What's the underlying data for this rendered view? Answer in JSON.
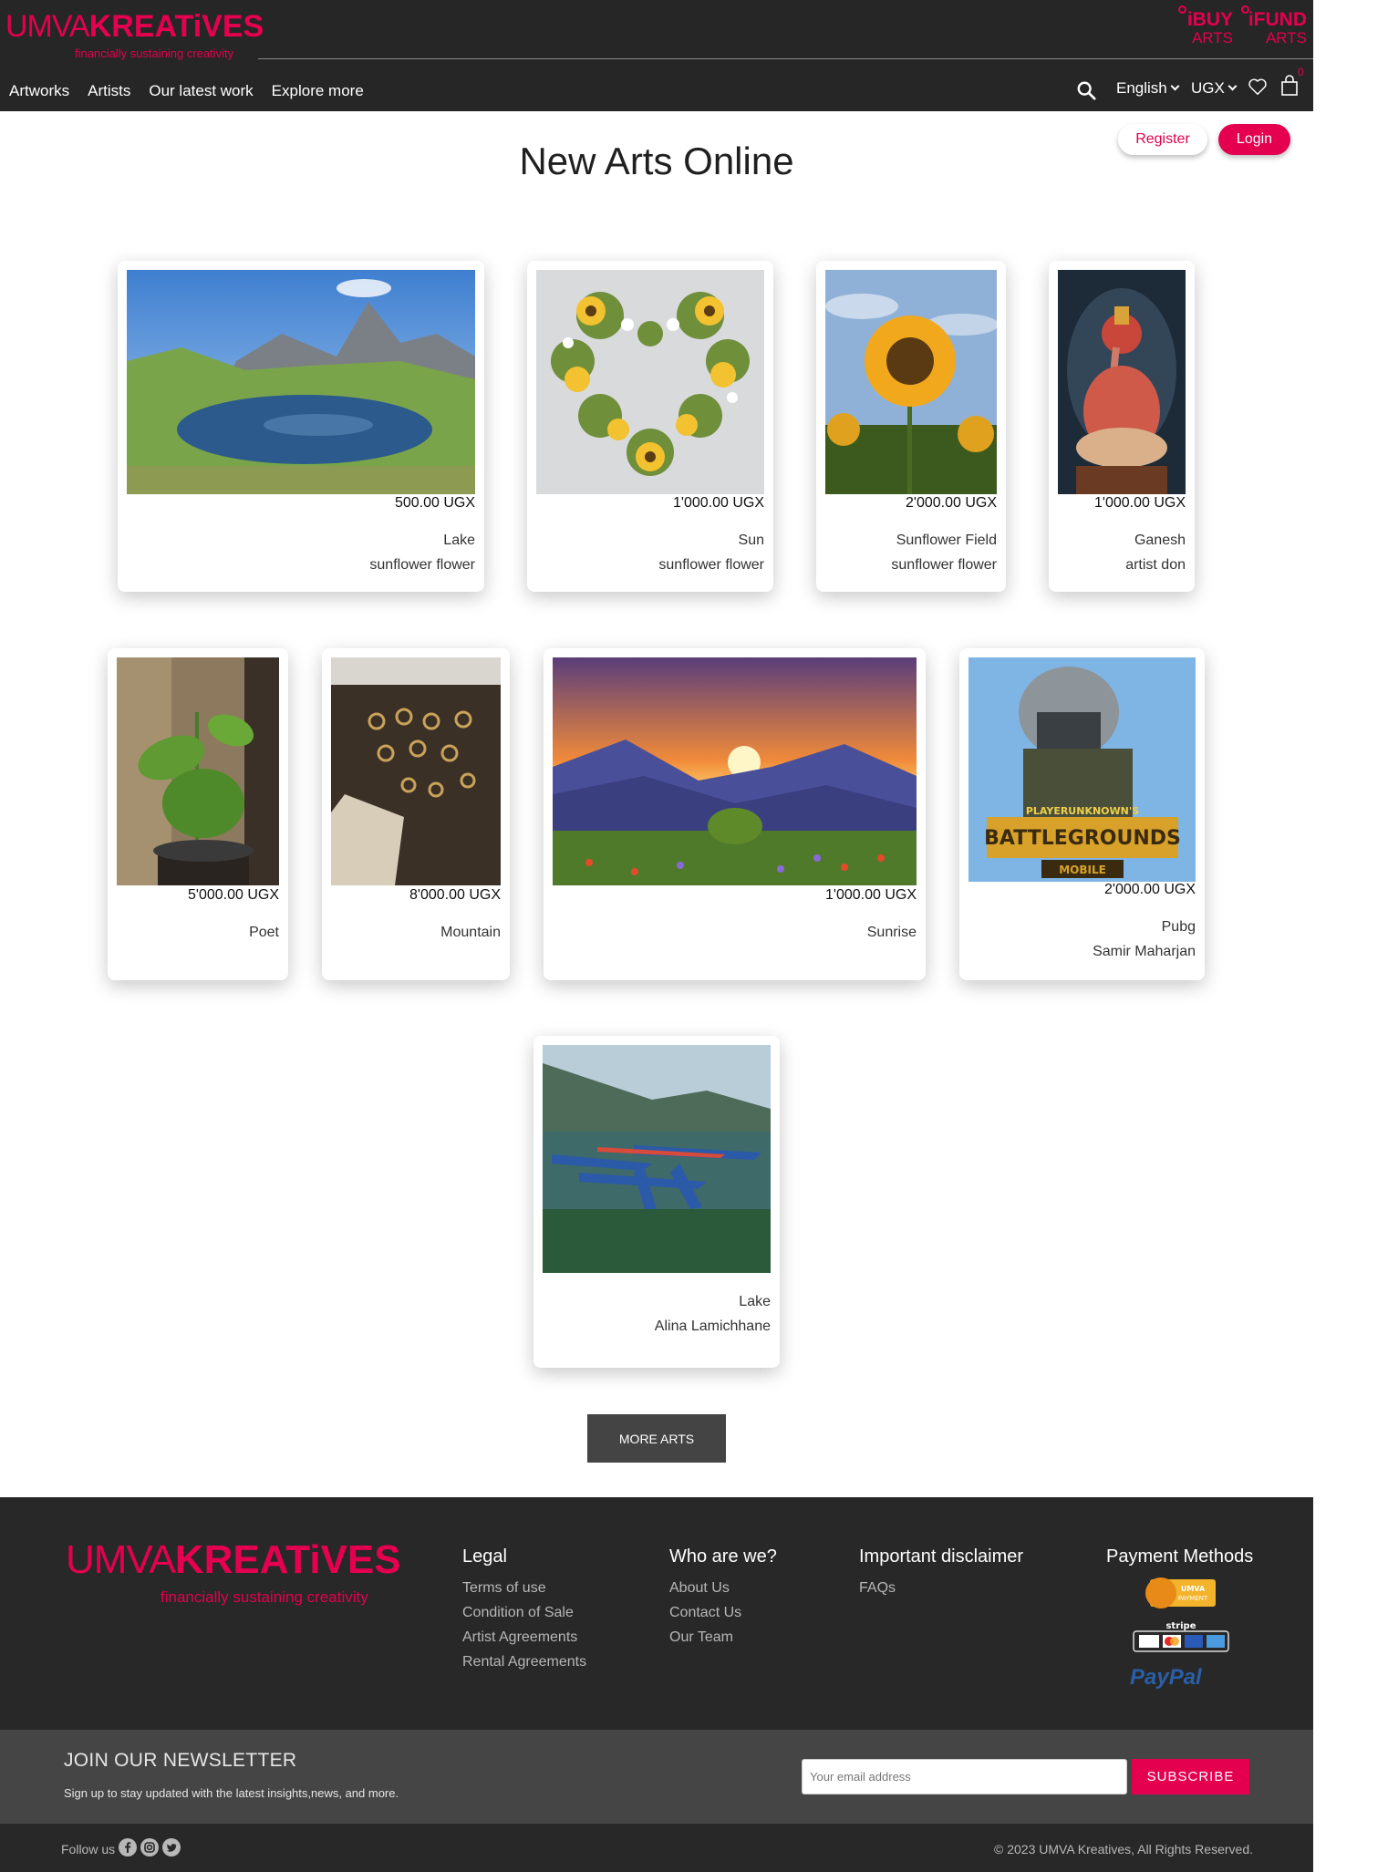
{
  "header": {
    "logo_umva": "UMVA",
    "logo_kreatives": "KREATiVES",
    "logo_tagline": "financially sustaining creativity",
    "ibuy_top": "iBUY",
    "ibuy_bottom": "ARTS",
    "ifund_top": "iFUND",
    "ifund_bottom": "ARTS",
    "nav": [
      "Artworks",
      "Artists",
      "Our latest work",
      "Explore more"
    ],
    "language": "English",
    "currency": "UGX",
    "cart_count": "0",
    "icons": [
      "search-icon",
      "heart-icon",
      "shopping-bag-icon",
      "chevron-down-icon"
    ]
  },
  "auth": {
    "register": "Register",
    "login": "Login"
  },
  "page_title": "New Arts Online",
  "cards": [
    {
      "price": "500.00 UGX",
      "title": "Lake",
      "artist": "sunflower flower"
    },
    {
      "price": "1'000.00 UGX",
      "title": "Sun",
      "artist": "sunflower flower"
    },
    {
      "price": "2'000.00 UGX",
      "title": "Sunflower Field",
      "artist": "sunflower flower"
    },
    {
      "price": "1'000.00 UGX",
      "title": "Ganesh",
      "artist": "artist don"
    },
    {
      "price": "5'000.00 UGX",
      "title": "Poet",
      "artist": ""
    },
    {
      "price": "8'000.00 UGX",
      "title": "Mountain",
      "artist": ""
    },
    {
      "price": "1'000.00 UGX",
      "title": "Sunrise",
      "artist": ""
    },
    {
      "price": "2'000.00 UGX",
      "title": "Pubg",
      "artist": "Samir Maharjan"
    },
    {
      "price": "",
      "title": "Lake",
      "artist": "Alina Lamichhane"
    }
  ],
  "more_arts": "MORE ARTS",
  "footer": {
    "logo_umva": "UMVA",
    "logo_kreatives": "KREATiVES",
    "logo_tagline": "financially sustaining creativity",
    "legal": {
      "heading": "Legal",
      "links": [
        "Terms of use",
        "Condition of Sale",
        "Artist Agreements",
        "Rental Agreements"
      ]
    },
    "who": {
      "heading": "Who are we?",
      "links": [
        "About Us",
        "Contact Us",
        "Our Team"
      ]
    },
    "disclaimer": {
      "heading": "Important disclaimer",
      "links": [
        "FAQs"
      ]
    },
    "payment": {
      "heading": "Payment Methods",
      "umva_line1": "UMVA",
      "umva_line2": "PAYMENT",
      "stripe": "stripe",
      "paypal": "PayPal"
    }
  },
  "newsletter": {
    "title": "JOIN OUR NEWSLETTER",
    "subtitle": "Sign up to stay updated with the latest insights,news, and more.",
    "placeholder": "Your email address",
    "button": "SUBSCRIBE"
  },
  "bottom": {
    "follow": "Follow us",
    "social_icons": [
      "facebook-icon",
      "instagram-icon",
      "twitter-icon"
    ],
    "copyright": "© 2023 UMVA Kreatives, All Rights Reserved."
  },
  "colors": {
    "accent": "#e4004f",
    "header_bg": "#262626",
    "footer_bg": "#282828",
    "newsletter_bg": "#454545"
  }
}
